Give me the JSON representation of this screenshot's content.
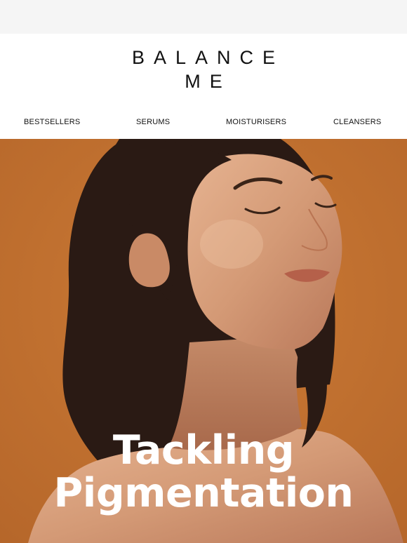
{
  "brand": {
    "logo_line1": "BALANCE",
    "logo_line2": "ME"
  },
  "nav": {
    "items": [
      {
        "label": "BESTSELLERS"
      },
      {
        "label": "SERUMS"
      },
      {
        "label": "MOISTURISERS"
      },
      {
        "label": "CLEANSERS"
      }
    ]
  },
  "hero": {
    "headline_line1": "Tackling",
    "headline_line2": "Pigmentation",
    "background_color": "#c2722f"
  }
}
